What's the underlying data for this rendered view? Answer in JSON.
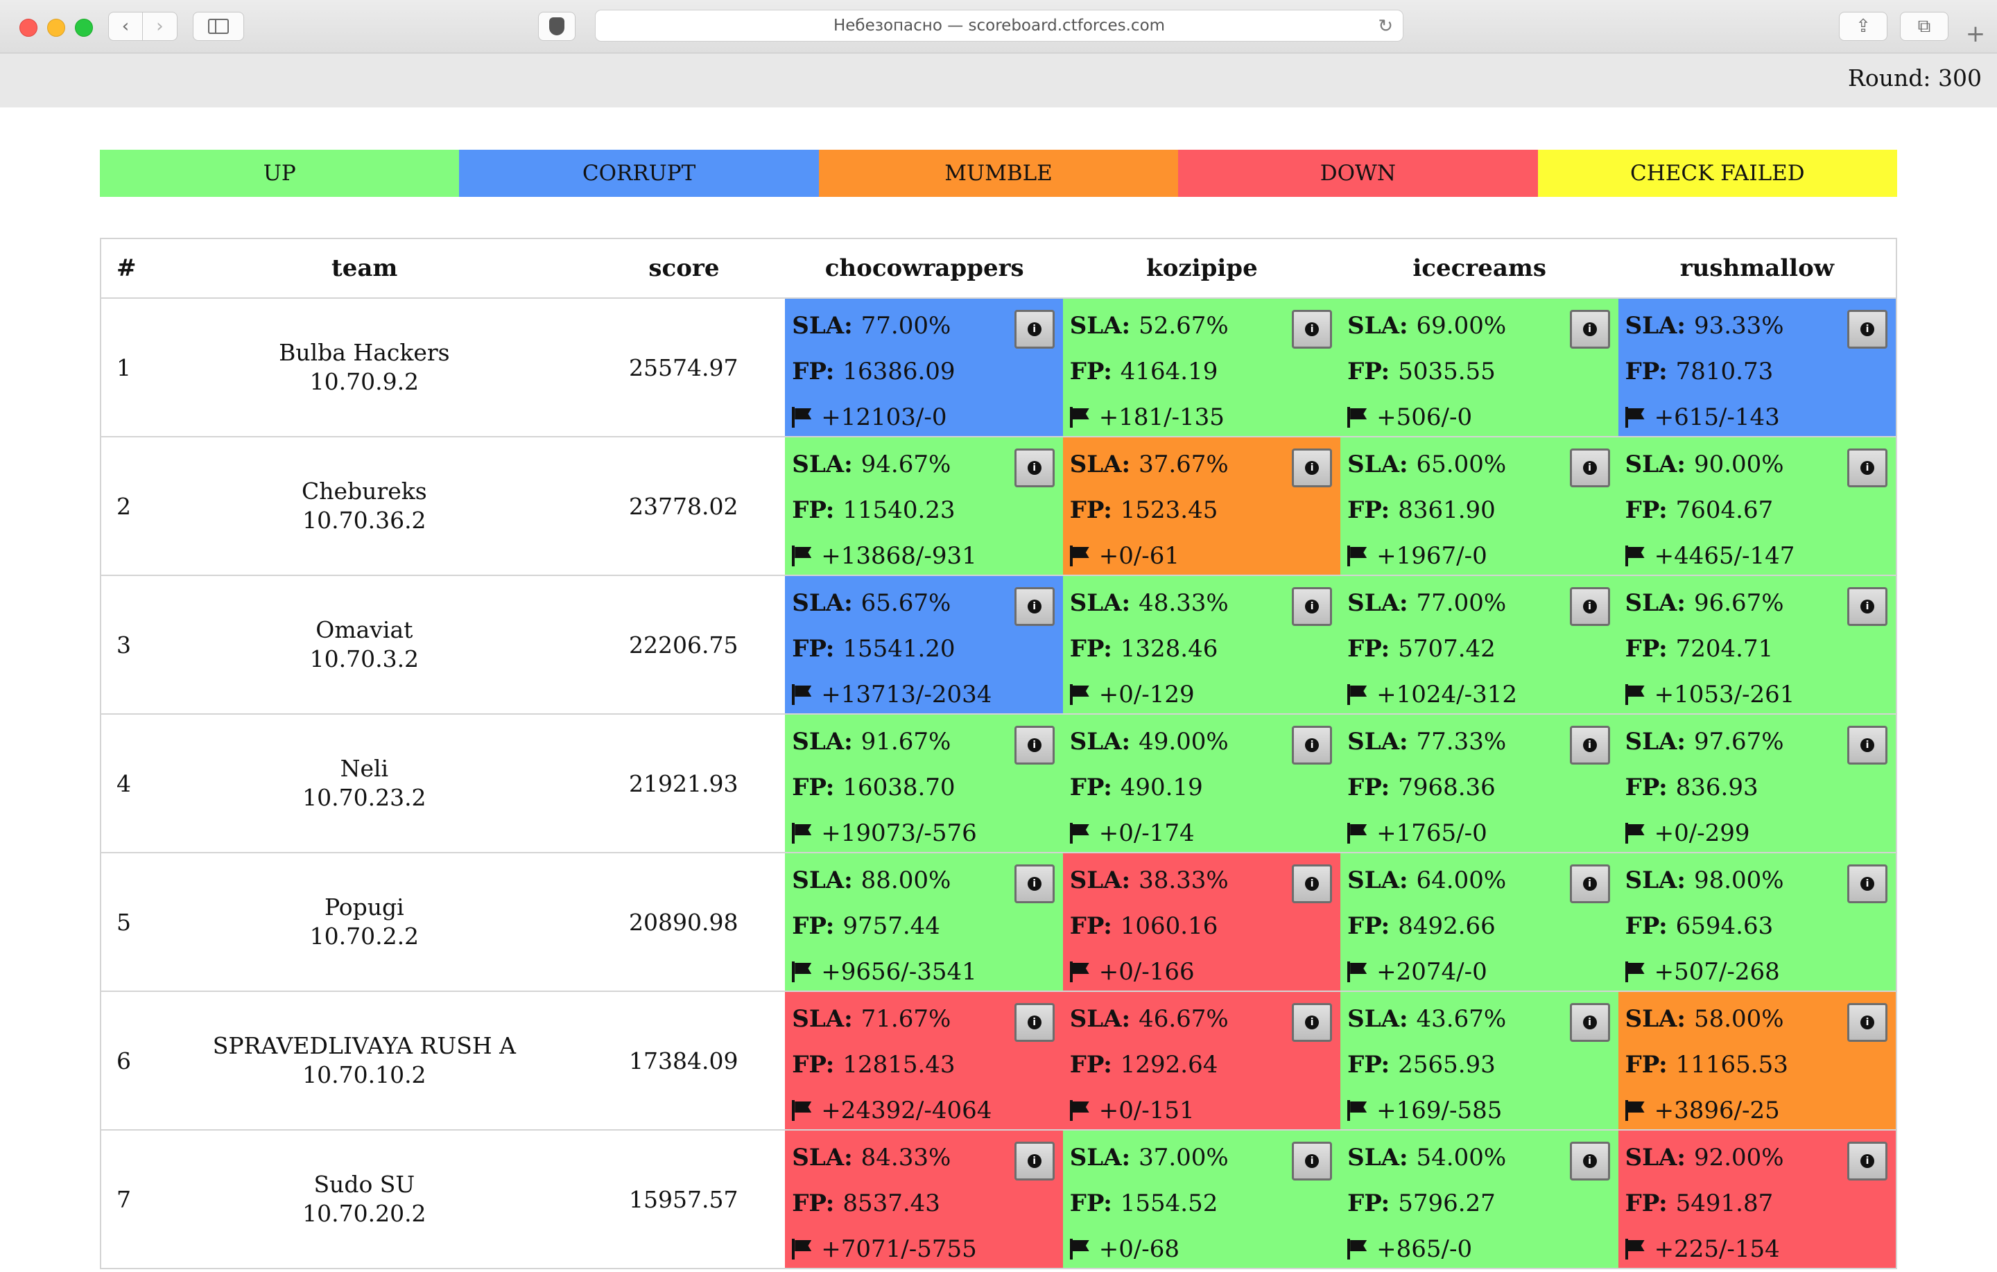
{
  "browser": {
    "address": "Небезопасно — scoreboard.ctforces.com"
  },
  "header": {
    "round": "Round: 300"
  },
  "legend": [
    {
      "label": "UP",
      "status": "up",
      "color": "#83fb7f"
    },
    {
      "label": "CORRUPT",
      "status": "corrupt",
      "color": "#5594f9"
    },
    {
      "label": "MUMBLE",
      "status": "mumble",
      "color": "#fd922e"
    },
    {
      "label": "DOWN",
      "status": "down",
      "color": "#fd5a63"
    },
    {
      "label": "CHECK FAILED",
      "status": "check",
      "color": "#fdfd34"
    }
  ],
  "table": {
    "headers": {
      "rank": "#",
      "team": "team",
      "score": "score",
      "services": [
        "chocowrappers",
        "kozipipe",
        "icecreams",
        "rushmallow"
      ]
    },
    "sla_label": "SLA:",
    "fp_label": "FP:",
    "rows": [
      {
        "rank": "1",
        "name": "Bulba Hackers",
        "ip": "10.70.9.2",
        "score": "25574.97",
        "services": [
          {
            "status": "corrupt",
            "sla": "77.00%",
            "fp": "16386.09",
            "flags": "+12103/-0"
          },
          {
            "status": "up",
            "sla": "52.67%",
            "fp": "4164.19",
            "flags": "+181/-135"
          },
          {
            "status": "up",
            "sla": "69.00%",
            "fp": "5035.55",
            "flags": "+506/-0"
          },
          {
            "status": "corrupt",
            "sla": "93.33%",
            "fp": "7810.73",
            "flags": "+615/-143"
          }
        ]
      },
      {
        "rank": "2",
        "name": "Chebureks",
        "ip": "10.70.36.2",
        "score": "23778.02",
        "services": [
          {
            "status": "up",
            "sla": "94.67%",
            "fp": "11540.23",
            "flags": "+13868/-931"
          },
          {
            "status": "mumble",
            "sla": "37.67%",
            "fp": "1523.45",
            "flags": "+0/-61"
          },
          {
            "status": "up",
            "sla": "65.00%",
            "fp": "8361.90",
            "flags": "+1967/-0"
          },
          {
            "status": "up",
            "sla": "90.00%",
            "fp": "7604.67",
            "flags": "+4465/-147"
          }
        ]
      },
      {
        "rank": "3",
        "name": "Omaviat",
        "ip": "10.70.3.2",
        "score": "22206.75",
        "services": [
          {
            "status": "corrupt",
            "sla": "65.67%",
            "fp": "15541.20",
            "flags": "+13713/-2034"
          },
          {
            "status": "up",
            "sla": "48.33%",
            "fp": "1328.46",
            "flags": "+0/-129"
          },
          {
            "status": "up",
            "sla": "77.00%",
            "fp": "5707.42",
            "flags": "+1024/-312"
          },
          {
            "status": "up",
            "sla": "96.67%",
            "fp": "7204.71",
            "flags": "+1053/-261"
          }
        ]
      },
      {
        "rank": "4",
        "name": "Neli",
        "ip": "10.70.23.2",
        "score": "21921.93",
        "services": [
          {
            "status": "up",
            "sla": "91.67%",
            "fp": "16038.70",
            "flags": "+19073/-576"
          },
          {
            "status": "up",
            "sla": "49.00%",
            "fp": "490.19",
            "flags": "+0/-174"
          },
          {
            "status": "up",
            "sla": "77.33%",
            "fp": "7968.36",
            "flags": "+1765/-0"
          },
          {
            "status": "up",
            "sla": "97.67%",
            "fp": "836.93",
            "flags": "+0/-299"
          }
        ]
      },
      {
        "rank": "5",
        "name": "Popugi",
        "ip": "10.70.2.2",
        "score": "20890.98",
        "services": [
          {
            "status": "up",
            "sla": "88.00%",
            "fp": "9757.44",
            "flags": "+9656/-3541"
          },
          {
            "status": "down",
            "sla": "38.33%",
            "fp": "1060.16",
            "flags": "+0/-166"
          },
          {
            "status": "up",
            "sla": "64.00%",
            "fp": "8492.66",
            "flags": "+2074/-0"
          },
          {
            "status": "up",
            "sla": "98.00%",
            "fp": "6594.63",
            "flags": "+507/-268"
          }
        ]
      },
      {
        "rank": "6",
        "name": "SPRAVEDLIVAYA RUSH A",
        "ip": "10.70.10.2",
        "score": "17384.09",
        "services": [
          {
            "status": "down",
            "sla": "71.67%",
            "fp": "12815.43",
            "flags": "+24392/-4064"
          },
          {
            "status": "down",
            "sla": "46.67%",
            "fp": "1292.64",
            "flags": "+0/-151"
          },
          {
            "status": "up",
            "sla": "43.67%",
            "fp": "2565.93",
            "flags": "+169/-585"
          },
          {
            "status": "mumble",
            "sla": "58.00%",
            "fp": "11165.53",
            "flags": "+3896/-25"
          }
        ]
      },
      {
        "rank": "7",
        "name": "Sudo SU",
        "ip": "10.70.20.2",
        "score": "15957.57",
        "services": [
          {
            "status": "down",
            "sla": "84.33%",
            "fp": "8537.43",
            "flags": "+7071/-5755"
          },
          {
            "status": "up",
            "sla": "37.00%",
            "fp": "1554.52",
            "flags": "+0/-68"
          },
          {
            "status": "up",
            "sla": "54.00%",
            "fp": "5796.27",
            "flags": "+865/-0"
          },
          {
            "status": "down",
            "sla": "92.00%",
            "fp": "5491.87",
            "flags": "+225/-154"
          }
        ]
      }
    ]
  }
}
